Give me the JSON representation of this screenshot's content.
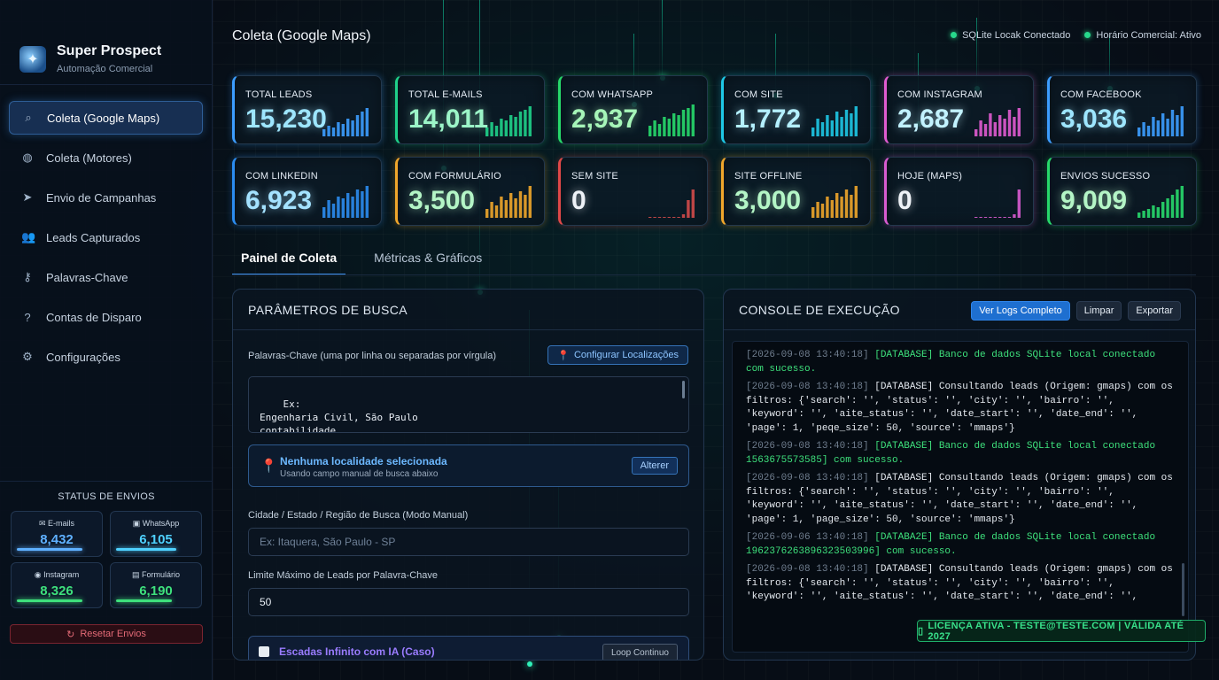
{
  "brand": {
    "title": "Super Prospect",
    "subtitle": "Automação Comercial"
  },
  "nav": [
    {
      "label": "Coleta (Google Maps)",
      "icon": "search-icon",
      "active": true
    },
    {
      "label": "Coleta (Motores)",
      "icon": "globe-icon"
    },
    {
      "label": "Envio de Campanhas",
      "icon": "send-icon"
    },
    {
      "label": "Leads Capturados",
      "icon": "users-icon"
    },
    {
      "label": "Palavras-Chave",
      "icon": "key-icon"
    },
    {
      "label": "Contas de Disparo",
      "icon": "help-icon"
    },
    {
      "label": "Configurações",
      "icon": "gear-icon"
    }
  ],
  "status": {
    "title": "STATUS DE ENVIOS",
    "items": [
      {
        "label": "E-mails",
        "value": "8,432",
        "color": "#5fb0ff",
        "fill": 0.82
      },
      {
        "label": "WhatsApp",
        "value": "6,105",
        "color": "#4fd1ff",
        "fill": 0.76
      },
      {
        "label": "Instagram",
        "value": "8,326",
        "color": "#3ee07c",
        "fill": 0.82
      },
      {
        "label": "Formulário",
        "value": "6,190",
        "color": "#3ee07c",
        "fill": 0.7
      }
    ],
    "reset": "Resetar Envios"
  },
  "header": {
    "title": "Coleta (Google Maps)",
    "status1": "SQLite Locak Conectado",
    "status2": "Horário Comercial: Ativo"
  },
  "cards": [
    {
      "label": "TOTAL LEADS",
      "value": "15,230",
      "color": "#3c9dff",
      "vcolor": "#9ee6ff"
    },
    {
      "label": "TOTAL E-MAILS",
      "value": "14,011",
      "color": "#1fd18a",
      "vcolor": "#9cf5c8"
    },
    {
      "label": "COM WHATSAPP",
      "value": "2,937",
      "color": "#27d96b",
      "vcolor": "#a6f5b8"
    },
    {
      "label": "COM SITE",
      "value": "1,772",
      "color": "#1ec8e6",
      "vcolor": "#b4f0ff"
    },
    {
      "label": "COM INSTAGRAM",
      "value": "2,687",
      "color": "#e05bd0",
      "vcolor": "#c2f2ff"
    },
    {
      "label": "COM FACEBOOK",
      "value": "3,036",
      "color": "#3c9dff",
      "vcolor": "#9ee6ff"
    },
    {
      "label": "COM LINKEDIN",
      "value": "6,923",
      "color": "#2b8cf0",
      "vcolor": "#a4e2ff"
    },
    {
      "label": "COM FORMULÁRIO",
      "value": "3,500",
      "color": "#f0a62b",
      "vcolor": "#b4f5c6"
    },
    {
      "label": "SEM SITE",
      "value": "0",
      "color": "#e04848",
      "vcolor": "#eef2f7"
    },
    {
      "label": "SITE OFFLINE",
      "value": "3,000",
      "color": "#f0a62b",
      "vcolor": "#b4f5c6"
    },
    {
      "label": "HOJE (MAPS)",
      "value": "0",
      "color": "#d85bd0",
      "vcolor": "#eef2f7"
    },
    {
      "label": "ENVIOS SUCESSO",
      "value": "9,009",
      "color": "#27d96b",
      "vcolor": "#b4f5c6"
    }
  ],
  "tabs": [
    {
      "label": "Painel de Coleta",
      "active": true
    },
    {
      "label": "Métricas & Gráficos"
    }
  ],
  "search": {
    "title": "PARÂMETROS DE BUSCA",
    "keywords_label": "Palavras-Chave (uma por linha ou separadas por vírgula)",
    "config_btn": "Configurar Localizações",
    "keywords_value": "Ex:\nEngenharia Civil, São Paulo\ncontabilidade\ndentista",
    "loc_title": "Nenhuma localidade selecionada",
    "loc_sub": "Usando campo manual de busca abaixo",
    "alter_btn": "Alterer",
    "city_label": "Cidade / Estado / Região de Busca (Modo Manual)",
    "city_placeholder": "Ex: Itaquera, São Paulo - SP",
    "limit_label": "Limite Máximo de Leads por Palavra-Chave",
    "limit_value": "50",
    "scan_label": "Escadas Infinito com IA (Caso)",
    "scan_btn": "Loop Continuo"
  },
  "console": {
    "title": "CONSOLE DE EXECUÇÃO",
    "btn_logs": "Ver Logs Completo",
    "btn_clear": "Limpar",
    "btn_export": "Exportar",
    "logs": [
      {
        "ts": "[2026-09-08 13:40:18]",
        "text": " [DATABASE] Banco de dados SQLite local conectado com sucesso.",
        "kind": "ok"
      },
      {
        "ts": "[2026-09-08 13:40:18]",
        "text": " [DATABASE] Consultando leads (Origem: gmaps) com os filtros: {'search': '', 'status': '', 'city': '', 'bairro': '', 'keyword': '', 'aite_status': '', 'date_start': '', 'date_end': '', 'page': 1, 'peqe_size': 50, 'source': 'mmaps'}",
        "kind": "info"
      },
      {
        "ts": "[2026-09-08 13:40:18]",
        "text": " [DATABASE] Banco de dados SQLite local conectado 1563675573585] com sucesso.",
        "kind": "ok"
      },
      {
        "ts": "[2026-09-08 13:40:18]",
        "text": " [DATABASE] Consultando leads (Origem: gmaps) com os filtros: {'search': '', 'status': '', 'city': '', 'bairro': '', 'keyword': '', 'aite_status': '', 'date_start': '', 'date_end': '', 'page': 1, 'page_size': 50, 'source': 'mmaps'}",
        "kind": "info"
      },
      {
        "ts": "[2026-09-06 13:40:18]",
        "text": " [DATABA2E] Banco de dados SQLite local conectado 1962376263896323503996] com sucesso.",
        "kind": "ok"
      },
      {
        "ts": "[2026-09-08 13:40:18]",
        "text": " [DATABASE] Consultando leads (Origem: gmaps) com os filtros: {'search': '', 'status': '', 'city': '', 'bairro': '', 'keyword': '', 'aite_status': '', 'date_start': '', 'date_end': '',",
        "kind": "info"
      }
    ]
  },
  "license": "LICENÇA ATIVA - TESTE@TESTE.COM | VÁLIDA ATÉ 2027"
}
